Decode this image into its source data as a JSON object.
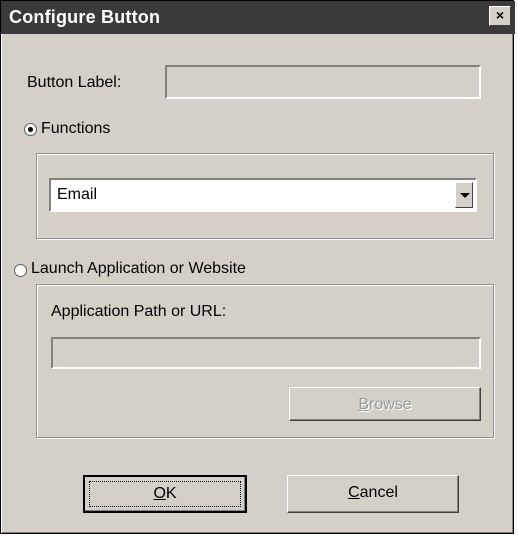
{
  "dialog": {
    "title": "Configure Button",
    "close_glyph": "×"
  },
  "button_label": {
    "label": "Button Label:",
    "value": ""
  },
  "functions": {
    "radio_label": "Functions",
    "selected": true,
    "dropdown_value": "Email"
  },
  "launch": {
    "radio_label": "Launch Application or Website",
    "selected": false,
    "path_label": "Application Path or URL:",
    "path_value": "",
    "browse": {
      "mnemonic": "B",
      "rest": "rowse",
      "enabled": false
    }
  },
  "buttons": {
    "ok": {
      "mnemonic": "O",
      "rest": "K"
    },
    "cancel": {
      "mnemonic": "C",
      "rest": "ancel"
    }
  }
}
